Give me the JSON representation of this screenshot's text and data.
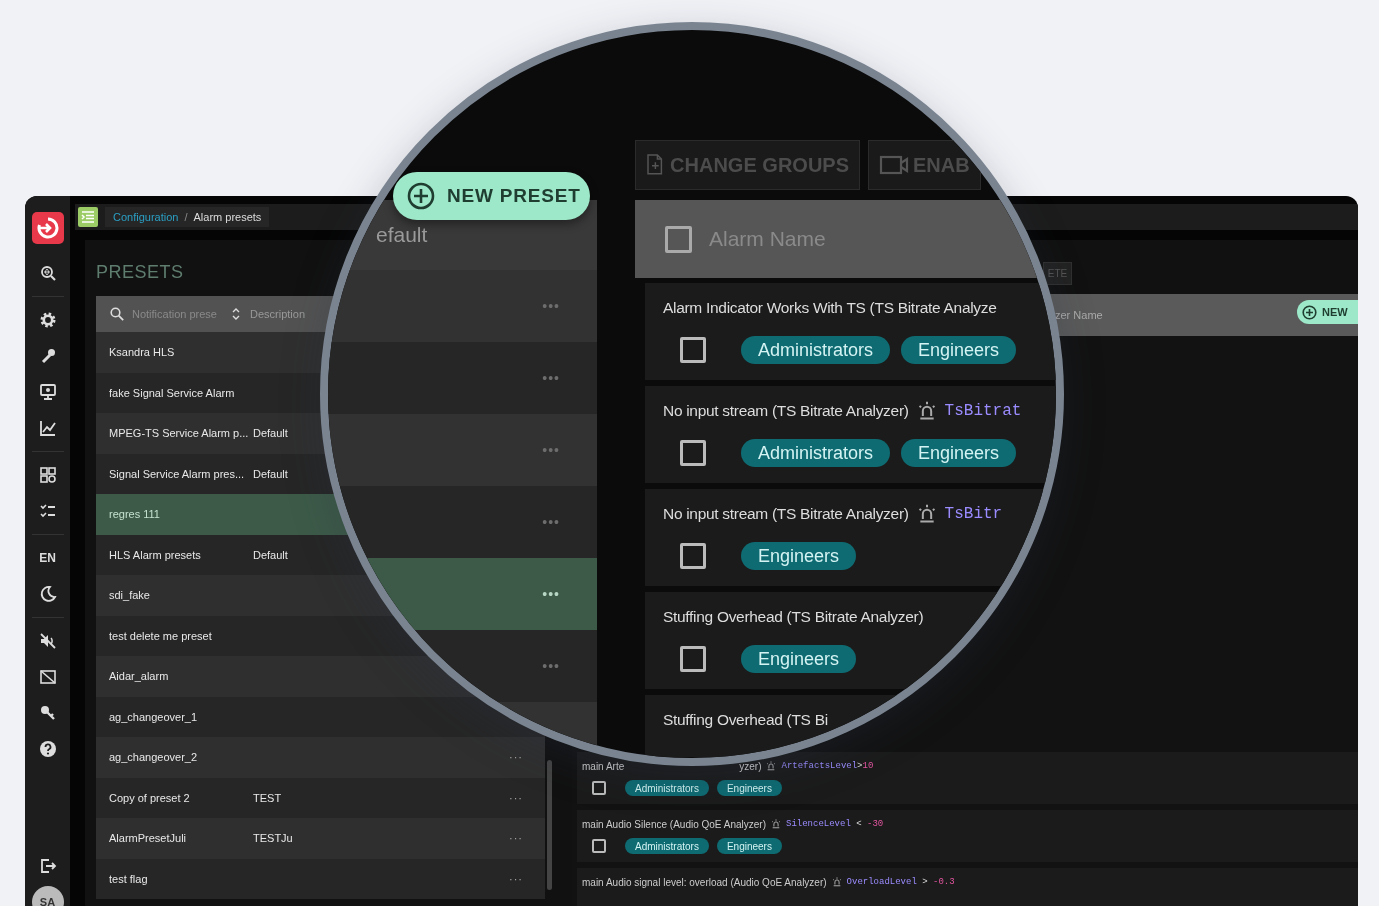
{
  "sidebar": {
    "language": "EN",
    "avatar": "SA"
  },
  "breadcrumb": {
    "separator": "/",
    "items": [
      {
        "label": "Configuration",
        "link": true
      },
      {
        "label": "Alarm presets",
        "link": false
      }
    ]
  },
  "presets": {
    "title": "PRESETS",
    "search_placeholder": "Notification prese",
    "columns": [
      "Description"
    ],
    "rows": [
      {
        "name": "Ksandra HLS",
        "selected": false
      },
      {
        "name": "fake Signal Service Alarm",
        "selected": false
      },
      {
        "name": "MPEG-TS Service Alarm p...",
        "description": "Default",
        "selected": false
      },
      {
        "name": "Signal Service Alarm pres...",
        "description": "Default",
        "selected": false
      },
      {
        "name": "regres 111",
        "selected": true
      },
      {
        "name": "HLS Alarm presets",
        "description": "Default",
        "selected": false
      },
      {
        "name": "sdi_fake",
        "selected": false
      },
      {
        "name": "test delete me preset",
        "selected": false
      },
      {
        "name": "Aidar_alarm",
        "selected": false
      },
      {
        "name": "ag_changeover_1",
        "selected": false
      },
      {
        "name": "ag_changeover_2",
        "selected": false,
        "menu": "···"
      },
      {
        "name": "Copy of preset 2",
        "description": "TEST",
        "selected": false,
        "menu": "···"
      },
      {
        "name": "AlarmPresetJuli",
        "description": "TESTJu",
        "selected": false,
        "menu": "···"
      },
      {
        "name": "test flag",
        "selected": false,
        "menu": "···"
      }
    ]
  },
  "alarms": {
    "delete_button": "ETE",
    "new_button": "NEW",
    "header": "zer Name",
    "cards": [
      {
        "title": "main Arte",
        "title_tail": "yzer)",
        "condition": {
          "key": "ArtefactsLevel",
          "op": ">",
          "value": "10"
        },
        "checked": false,
        "groups": [
          "Administrators",
          "Engineers"
        ]
      },
      {
        "title": "main Audio Silence (Audio QoE Analyzer)",
        "condition": {
          "key": "SilenceLevel",
          "op": " < ",
          "value": "-30"
        },
        "checked": false,
        "groups": [
          "Administrators",
          "Engineers"
        ]
      },
      {
        "title": "main Audio signal level: overload (Audio QoE Analyzer)",
        "condition": {
          "key": "OverloadLevel",
          "op": " > ",
          "value": "-0.3"
        }
      }
    ]
  },
  "magnifier": {
    "new_button": "NEW PRESET",
    "presets_header": "efault",
    "rows": [
      {
        "selected": false,
        "menu": "•••"
      },
      {
        "selected": false,
        "menu": "•••"
      },
      {
        "selected": false,
        "menu": "•••"
      },
      {
        "selected": false,
        "menu": "•••"
      },
      {
        "selected": true,
        "menu": "•••"
      },
      {
        "selected": false,
        "menu": "•••"
      },
      {
        "selected": false
      }
    ],
    "tabs": [
      {
        "label": "CHANGE GROUPS",
        "kind": "groups"
      },
      {
        "label": "ENAB",
        "kind": "enable"
      }
    ],
    "header": "Alarm Name",
    "header_checked": false,
    "cards": [
      {
        "title": "Alarm Indicator Works With TS (TS Bitrate Analyze",
        "checked": false,
        "groups": [
          "Administrators",
          "Engineers"
        ]
      },
      {
        "title": "No input stream (TS Bitrate Analyzer)",
        "condition": {
          "key": "TsBitrat"
        },
        "checked": false,
        "groups": [
          "Administrators",
          "Engineers"
        ]
      },
      {
        "title": "No input stream (TS Bitrate Analyzer)",
        "condition": {
          "key": "TsBitr"
        },
        "checked": false,
        "groups": [
          "Engineers"
        ]
      },
      {
        "title": "Stuffing Overhead (TS Bitrate Analyzer)",
        "checked": false,
        "groups": [
          "Engineers"
        ]
      },
      {
        "title": "Stuffing Overhead (TS Bi"
      }
    ]
  }
}
